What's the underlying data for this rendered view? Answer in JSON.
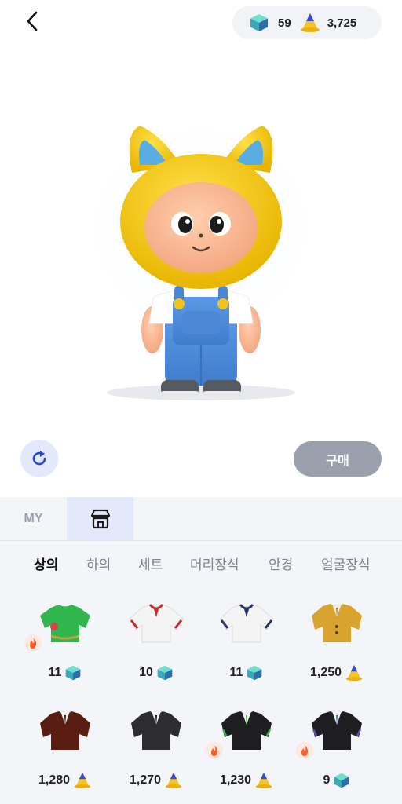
{
  "header": {
    "gems": "59",
    "cones": "3,725"
  },
  "actions": {
    "buy_label": "구매"
  },
  "tabs": {
    "my_label": "MY"
  },
  "categories": [
    "상의",
    "하의",
    "세트",
    "머리장식",
    "안경",
    "얼굴장식"
  ],
  "items": [
    {
      "price": "11",
      "currency": "gem",
      "hot": true
    },
    {
      "price": "10",
      "currency": "gem",
      "hot": false
    },
    {
      "price": "11",
      "currency": "gem",
      "hot": false
    },
    {
      "price": "1,250",
      "currency": "cone",
      "hot": false
    },
    {
      "price": "1,280",
      "currency": "cone",
      "hot": false
    },
    {
      "price": "1,270",
      "currency": "cone",
      "hot": false
    },
    {
      "price": "1,230",
      "currency": "cone",
      "hot": true
    },
    {
      "price": "9",
      "currency": "gem",
      "hot": true
    }
  ]
}
